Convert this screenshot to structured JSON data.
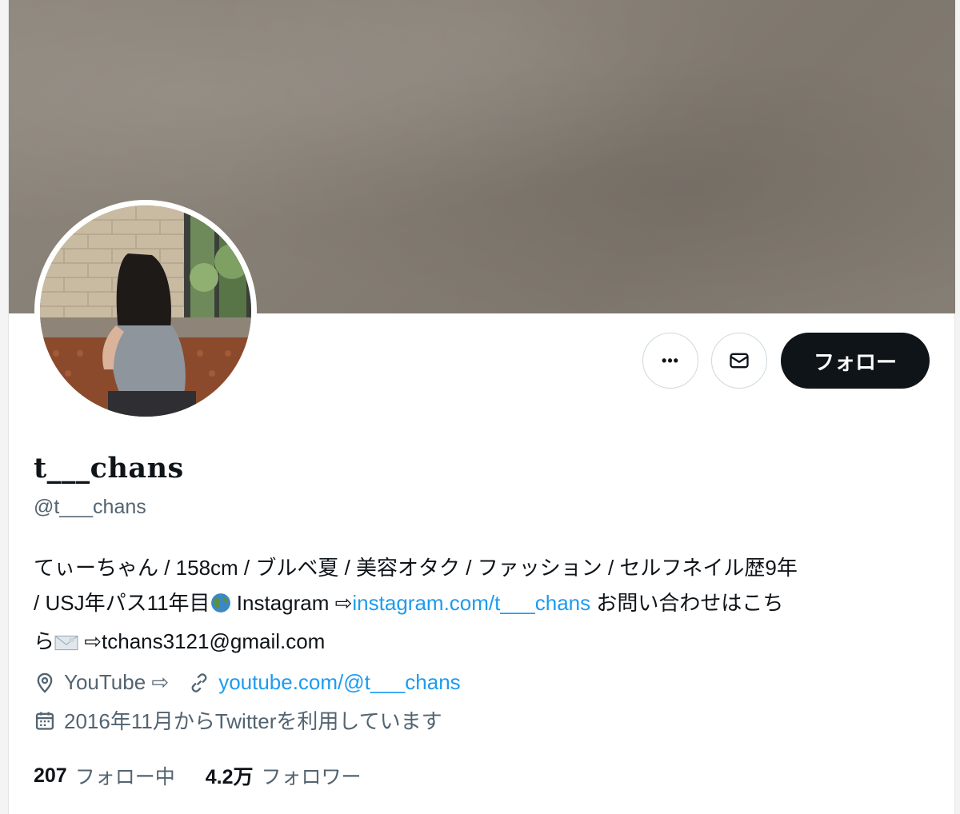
{
  "profile": {
    "display_name": "t___chans",
    "handle": "@t___chans",
    "bio": {
      "line1": "てぃーちゃん / 158cm / ブルベ夏 / 美容オタク / ファッション / セルフネイル歴9年",
      "line2_prefix": "/ USJ年パス11年目",
      "line2_instagram_label": " Instagram ⇨",
      "line2_instagram_link": "instagram.com/t___chans",
      "line2_suffix": " お問い合わせはこち",
      "line3_prefix": "ら",
      "line3_suffix": " ⇨tchans3121@gmail.com"
    },
    "location": "YouTube ⇨",
    "website": "youtube.com/@t___chans",
    "joined": "2016年11月からTwitterを利用しています"
  },
  "actions": {
    "more_label": "•••",
    "follow_label": "フォロー"
  },
  "stats": {
    "following_count": "207",
    "following_label": "フォロー中",
    "followers_count": "4.2万",
    "followers_label": "フォロワー"
  },
  "colors": {
    "link": "#1d9bf0",
    "secondary_text": "#536471",
    "primary_text": "#0f1419",
    "follow_button_bg": "#0f1419",
    "banner": "#857e74"
  },
  "icons": {
    "more": "more-icon",
    "message": "envelope-icon",
    "globe": "globe-emoji-icon",
    "envelope_emoji": "envelope-emoji-icon",
    "location": "location-pin-icon",
    "website": "link-icon",
    "joined": "calendar-icon"
  }
}
